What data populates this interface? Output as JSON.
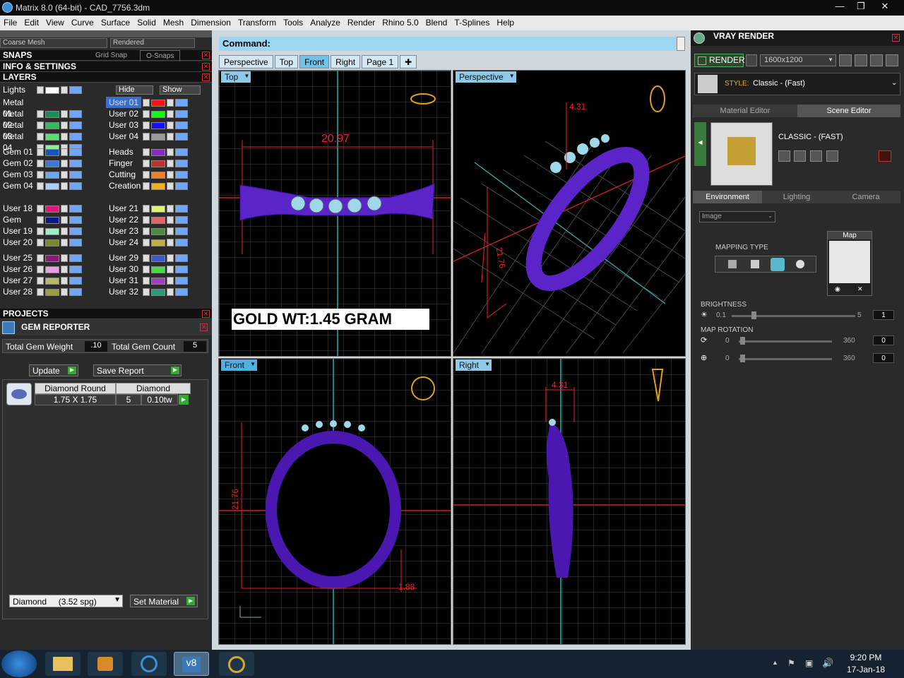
{
  "window": {
    "title": "Matrix 8.0 (64-bit) - CAD_7756.3dm"
  },
  "menu": [
    "File",
    "Edit",
    "View",
    "Curve",
    "Surface",
    "Solid",
    "Mesh",
    "Dimension",
    "Transform",
    "Tools",
    "Analyze",
    "Render",
    "Rhino 5.0",
    "Blend",
    "T-Splines",
    "Help"
  ],
  "left": {
    "mesh_combo": "Coarse Mesh",
    "render_combo": "Rendered",
    "snaps": {
      "title": "SNAPS",
      "grid": "Grid Snap",
      "osnap": "O-Snaps"
    },
    "info_title": "INFO & SETTINGS",
    "layers_title": "LAYERS",
    "lights": "Lights",
    "hide": "Hide",
    "show": "Show",
    "layers_left": [
      {
        "name": "Metal 01",
        "color": "#1e8a5a"
      },
      {
        "name": "Metal 02",
        "color": "#38b85e"
      },
      {
        "name": "Metal 03",
        "color": "#5fdc6e"
      },
      {
        "name": "Metal 04",
        "color": "#8ef09a"
      },
      {
        "name": "Gem 01",
        "color": "#1e4fc4"
      },
      {
        "name": "Gem 02",
        "color": "#3a78dc"
      },
      {
        "name": "Gem 03",
        "color": "#6aa8f0"
      },
      {
        "name": "Gem 04",
        "color": "#a8d0f8"
      },
      {
        "name": "User 18",
        "color": "#e0167c"
      },
      {
        "name": "Gem",
        "color": "#0a1a8a"
      },
      {
        "name": "User 19",
        "color": "#9ff0c8"
      },
      {
        "name": "User 20",
        "color": "#7a8a2a"
      },
      {
        "name": "User 25",
        "color": "#8a1a7a"
      },
      {
        "name": "User 26",
        "color": "#e8a0e0"
      },
      {
        "name": "User 27",
        "color": "#b8b868"
      },
      {
        "name": "User 28",
        "color": "#9aa040"
      }
    ],
    "layers_right": [
      {
        "name": "User 01",
        "color": "#ff1010"
      },
      {
        "name": "User 02",
        "color": "#10ff10"
      },
      {
        "name": "User 03",
        "color": "#1010ff"
      },
      {
        "name": "User 04",
        "color": "#999999"
      },
      {
        "name": "Heads",
        "color": "#8a2ac4"
      },
      {
        "name": "Finger",
        "color": "#c43030"
      },
      {
        "name": "Cutting",
        "color": "#f08020"
      },
      {
        "name": "Creation",
        "color": "#f0b020"
      },
      {
        "name": "User 21",
        "color": "#e0f070"
      },
      {
        "name": "User 22",
        "color": "#e86060"
      },
      {
        "name": "User 23",
        "color": "#4a8a3a"
      },
      {
        "name": "User 24",
        "color": "#c0b040"
      },
      {
        "name": "User 29",
        "color": "#3a5ad0"
      },
      {
        "name": "User 30",
        "color": "#48d848"
      },
      {
        "name": "User 31",
        "color": "#a040c0"
      },
      {
        "name": "User 32",
        "color": "#2a9a7a"
      }
    ],
    "projects_title": "PROJECTS",
    "gem_reporter": "GEM REPORTER",
    "total_weight_label": "Total Gem Weight",
    "total_weight": ".10",
    "total_count_label": "Total Gem Count",
    "total_count": "5",
    "update": "Update",
    "save_report": "Save Report",
    "gem_table": {
      "h1": "Diamond Round",
      "h2": "Diamond",
      "size": "1.75 X 1.75",
      "count": "5",
      "tw": "0.10tw"
    },
    "material": "Diamond     (3.52 spg)",
    "set_material": "Set Material"
  },
  "command": {
    "label": "Command:"
  },
  "tabs": [
    "Perspective",
    "Top",
    "Front",
    "Right",
    "Page 1"
  ],
  "viewports": {
    "top": {
      "label": "Top",
      "dim": "20.97"
    },
    "perspective": {
      "label": "Perspective",
      "dim1": "4.31",
      "dim2": "21.76"
    },
    "front": {
      "label": "Front",
      "dim1": "21.76",
      "dim2": "1.88"
    },
    "right": {
      "label": "Right",
      "dim": "4.31"
    },
    "gold": "GOLD WT:1.45 GRAM"
  },
  "right": {
    "title": "VRAY RENDER",
    "render": "RENDER",
    "resolution": "1600x1200",
    "style_label": "STYLE:",
    "style_value": "Classic - (Fast)",
    "tab_material": "Material Editor",
    "tab_scene": "Scene Editor",
    "preset": "CLASSIC - (FAST)",
    "env_tabs": [
      "Environment",
      "Lighting",
      "Camera"
    ],
    "env_mode": "Image",
    "mapping_type": "MAPPING TYPE",
    "map_label": "Map",
    "brightness_label": "BRIGHTNESS",
    "brightness_min": "0.1",
    "brightness_max": "5",
    "brightness_val": "1",
    "rotation_label": "MAP ROTATION",
    "rot1_min": "0",
    "rot1_max": "360",
    "rot1_val": "0",
    "rot2_min": "0",
    "rot2_max": "360",
    "rot2_val": "0"
  },
  "taskbar": {
    "time": "9:20 PM",
    "date": "17-Jan-18"
  }
}
